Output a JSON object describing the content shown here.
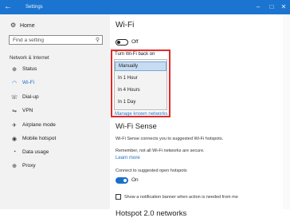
{
  "window": {
    "title": "Settings",
    "back_glyph": "←",
    "minimize_glyph": "–",
    "maximize_glyph": "□",
    "close_glyph": "✕"
  },
  "sidebar": {
    "home_label": "Home",
    "search_placeholder": "Find a setting",
    "section_label": "Network & Internet",
    "items": [
      {
        "label": "Status",
        "icon": "globe-icon",
        "glyph": "⊕"
      },
      {
        "label": "Wi-Fi",
        "icon": "wifi-icon",
        "glyph": "◠",
        "selected": true
      },
      {
        "label": "Dial-up",
        "icon": "phone-icon",
        "glyph": "☏"
      },
      {
        "label": "VPN",
        "icon": "vpn-icon",
        "glyph": "⇋"
      },
      {
        "label": "Airplane mode",
        "icon": "airplane-icon",
        "glyph": "✈"
      },
      {
        "label": "Mobile hotspot",
        "icon": "hotspot-icon",
        "glyph": "◉"
      },
      {
        "label": "Data usage",
        "icon": "data-usage-icon",
        "glyph": "◔"
      },
      {
        "label": "Proxy",
        "icon": "globe-icon",
        "glyph": "⊕"
      }
    ]
  },
  "main": {
    "title": "Wi-Fi",
    "wifi_toggle": {
      "state": "Off",
      "on": false
    },
    "turn_on_label": "Turn Wi-Fi back on",
    "dropdown_options": [
      "Manually",
      "In 1 Hour",
      "In 4 Hours",
      "In 1 Day"
    ],
    "dropdown_selected": "Manually",
    "manage_link": "Manage known networks",
    "sense_title": "Wi-Fi Sense",
    "sense_desc": "Wi-Fi Sense connects you to suggested Wi-Fi hotspots.",
    "sense_note": "Remember, not all Wi-Fi networks are secure.",
    "learn_more": "Learn more",
    "connect_label": "Connect to suggested open hotspots",
    "connect_toggle": {
      "state": "On",
      "on": true
    },
    "banner_checkbox_label": "Show a notification banner when action is needed from me",
    "hotspot_title": "Hotspot 2.0 networks"
  },
  "colors": {
    "accent": "#1a6fc8",
    "titlebar": "#1b75d0",
    "highlight": "#e22a2a"
  }
}
